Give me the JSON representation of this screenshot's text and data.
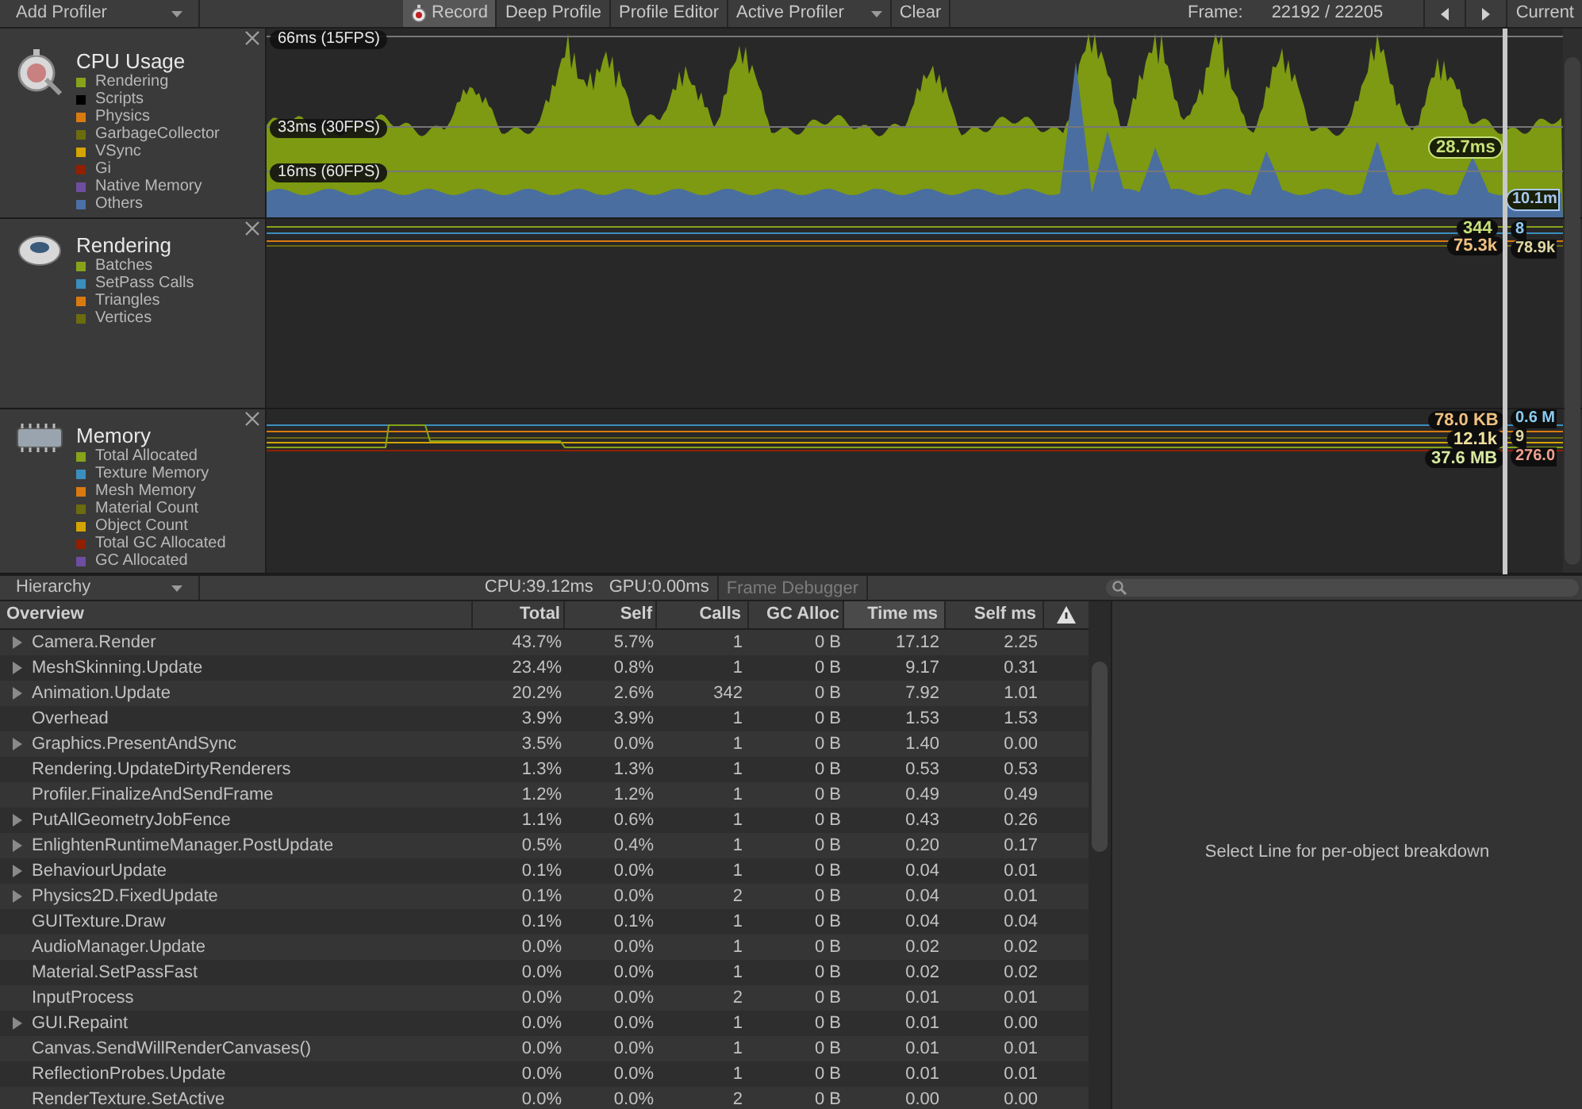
{
  "toolbar": {
    "add_profiler": "Add Profiler",
    "buttons": [
      {
        "label": "Record",
        "kind": "record",
        "selected": true
      },
      {
        "label": "Deep Profile",
        "kind": "toggle",
        "selected": false
      },
      {
        "label": "Profile Editor",
        "kind": "toggle",
        "selected": false
      },
      {
        "label": "Active Profiler",
        "kind": "dropdown",
        "selected": false
      },
      {
        "label": "Clear",
        "kind": "button",
        "selected": false
      }
    ],
    "frame_label": "Frame:",
    "frame_value": "22192 / 22205",
    "current": "Current"
  },
  "profilers": [
    {
      "kind": "cpu",
      "title": "CPU Usage",
      "legend": [
        {
          "label": "Rendering",
          "color": "#86a31a"
        },
        {
          "label": "Scripts",
          "color": "#000000"
        },
        {
          "label": "Physics",
          "color": "#d97a10"
        },
        {
          "label": "GarbageCollector",
          "color": "#6b6b10"
        },
        {
          "label": "VSync",
          "color": "#d4a500"
        },
        {
          "label": "Gi",
          "color": "#902000"
        },
        {
          "label": "Native Memory",
          "color": "#6e4ea0"
        },
        {
          "label": "Others",
          "color": "#4a70a8"
        }
      ],
      "guides": [
        "66ms (15FPS)",
        "33ms (30FPS)",
        "16ms (60FPS)"
      ],
      "values": [
        {
          "text": "28.7ms",
          "color": "#c8e07a"
        },
        {
          "text": "10.1m",
          "color": "#a8c8f0"
        }
      ]
    },
    {
      "kind": "rendering",
      "title": "Rendering",
      "legend": [
        {
          "label": "Batches",
          "color": "#86a31a"
        },
        {
          "label": "SetPass Calls",
          "color": "#3a8fbf"
        },
        {
          "label": "Triangles",
          "color": "#d97a10"
        },
        {
          "label": "Vertices",
          "color": "#6b6b10"
        }
      ],
      "values": [
        {
          "text": "344",
          "color": "#c8e07a"
        },
        {
          "text": "8",
          "color": "#8ccbf0"
        },
        {
          "text": "75.3k",
          "color": "#f0c080"
        },
        {
          "text": "78.9k",
          "color": "#e0d8a0"
        }
      ]
    },
    {
      "kind": "memory",
      "title": "Memory",
      "legend": [
        {
          "label": "Total Allocated",
          "color": "#86a31a"
        },
        {
          "label": "Texture Memory",
          "color": "#3a8fbf"
        },
        {
          "label": "Mesh Memory",
          "color": "#d97a10"
        },
        {
          "label": "Material Count",
          "color": "#6b6b10"
        },
        {
          "label": "Object Count",
          "color": "#d4a500"
        },
        {
          "label": "Total GC Allocated",
          "color": "#902000"
        },
        {
          "label": "GC Allocated",
          "color": "#6e4ea0"
        }
      ],
      "values": [
        {
          "text": "78.0 KB",
          "color": "#f0c080"
        },
        {
          "text": "0.6 M",
          "color": "#8ccbf0"
        },
        {
          "text": "12.1k",
          "color": "#f0e0a0"
        },
        {
          "text": "9",
          "color": "#e0d8a0"
        },
        {
          "text": "37.6 MB",
          "color": "#d8e8a0"
        },
        {
          "text": "276.0",
          "color": "#f0a090"
        }
      ]
    }
  ],
  "details_bar": {
    "view": "Hierarchy",
    "cpu": "CPU:39.12ms",
    "gpu": "GPU:0.00ms",
    "frame_debugger": "Frame Debugger"
  },
  "table": {
    "columns": [
      {
        "label": "Overview",
        "selected": false
      },
      {
        "label": "Total",
        "selected": false
      },
      {
        "label": "Self",
        "selected": false
      },
      {
        "label": "Calls",
        "selected": false
      },
      {
        "label": "GC Alloc",
        "selected": false
      },
      {
        "label": "Time ms",
        "selected": true
      },
      {
        "label": "Self ms",
        "selected": false
      }
    ],
    "rows": [
      {
        "expandable": true,
        "cells": [
          "Camera.Render",
          "43.7%",
          "5.7%",
          "1",
          "0 B",
          "17.12",
          "2.25"
        ]
      },
      {
        "expandable": true,
        "cells": [
          "MeshSkinning.Update",
          "23.4%",
          "0.8%",
          "1",
          "0 B",
          "9.17",
          "0.31"
        ]
      },
      {
        "expandable": true,
        "cells": [
          "Animation.Update",
          "20.2%",
          "2.6%",
          "342",
          "0 B",
          "7.92",
          "1.01"
        ]
      },
      {
        "expandable": false,
        "cells": [
          "Overhead",
          "3.9%",
          "3.9%",
          "1",
          "0 B",
          "1.53",
          "1.53"
        ]
      },
      {
        "expandable": true,
        "cells": [
          "Graphics.PresentAndSync",
          "3.5%",
          "0.0%",
          "1",
          "0 B",
          "1.40",
          "0.00"
        ]
      },
      {
        "expandable": false,
        "cells": [
          "Rendering.UpdateDirtyRenderers",
          "1.3%",
          "1.3%",
          "1",
          "0 B",
          "0.53",
          "0.53"
        ]
      },
      {
        "expandable": false,
        "cells": [
          "Profiler.FinalizeAndSendFrame",
          "1.2%",
          "1.2%",
          "1",
          "0 B",
          "0.49",
          "0.49"
        ]
      },
      {
        "expandable": true,
        "cells": [
          "PutAllGeometryJobFence",
          "1.1%",
          "0.6%",
          "1",
          "0 B",
          "0.43",
          "0.26"
        ]
      },
      {
        "expandable": true,
        "cells": [
          "EnlightenRuntimeManager.PostUpdate",
          "0.5%",
          "0.4%",
          "1",
          "0 B",
          "0.20",
          "0.17"
        ]
      },
      {
        "expandable": true,
        "cells": [
          "BehaviourUpdate",
          "0.1%",
          "0.0%",
          "1",
          "0 B",
          "0.04",
          "0.01"
        ]
      },
      {
        "expandable": true,
        "cells": [
          "Physics2D.FixedUpdate",
          "0.1%",
          "0.0%",
          "2",
          "0 B",
          "0.04",
          "0.01"
        ]
      },
      {
        "expandable": false,
        "cells": [
          "GUITexture.Draw",
          "0.1%",
          "0.1%",
          "1",
          "0 B",
          "0.04",
          "0.04"
        ]
      },
      {
        "expandable": false,
        "cells": [
          "AudioManager.Update",
          "0.0%",
          "0.0%",
          "1",
          "0 B",
          "0.02",
          "0.02"
        ]
      },
      {
        "expandable": false,
        "cells": [
          "Material.SetPassFast",
          "0.0%",
          "0.0%",
          "1",
          "0 B",
          "0.02",
          "0.02"
        ]
      },
      {
        "expandable": false,
        "cells": [
          "InputProcess",
          "0.0%",
          "0.0%",
          "2",
          "0 B",
          "0.01",
          "0.01"
        ]
      },
      {
        "expandable": true,
        "cells": [
          "GUI.Repaint",
          "0.0%",
          "0.0%",
          "1",
          "0 B",
          "0.01",
          "0.00"
        ]
      },
      {
        "expandable": false,
        "cells": [
          "Canvas.SendWillRenderCanvases()",
          "0.0%",
          "0.0%",
          "1",
          "0 B",
          "0.01",
          "0.01"
        ]
      },
      {
        "expandable": false,
        "cells": [
          "ReflectionProbes.Update",
          "0.0%",
          "0.0%",
          "1",
          "0 B",
          "0.01",
          "0.01"
        ]
      },
      {
        "expandable": false,
        "cells": [
          "RenderTexture.SetActive",
          "0.0%",
          "0.0%",
          "2",
          "0 B",
          "0.00",
          "0.00"
        ]
      }
    ]
  },
  "detail_panel": {
    "message": "Select Line for per-object breakdown"
  }
}
